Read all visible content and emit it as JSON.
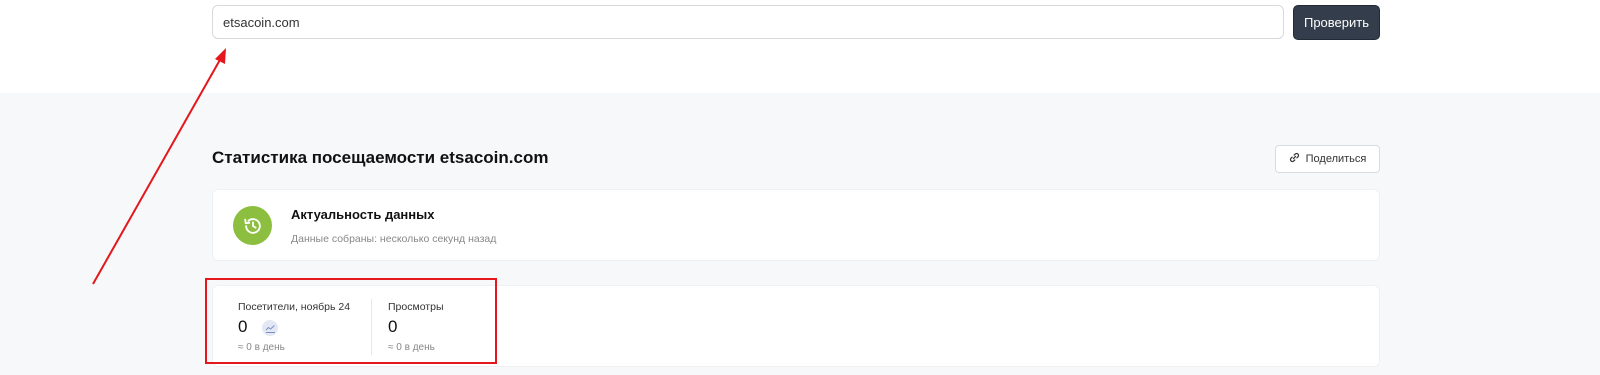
{
  "search": {
    "value": "etsacoin.com",
    "button_label": "Проверить"
  },
  "stats_section": {
    "title": "Статистика посещаемости etsacoin.com",
    "share_label": "Поделиться"
  },
  "freshness": {
    "icon": "history-clock-icon",
    "title": "Актуальность данных",
    "subtitle": "Данные собраны: несколько секунд назад"
  },
  "stats": {
    "visitors": {
      "label": "Посетители, ноябрь 24",
      "value": "0",
      "per_day": "≈ 0 в день",
      "badge_icon": "chart-icon"
    },
    "views": {
      "label": "Просмотры",
      "value": "0",
      "per_day": "≈ 0 в день"
    }
  },
  "colors": {
    "accent_dark": "#343d4b",
    "freshness_green": "#8cbf3f",
    "annotation_red": "#e3171c",
    "section_bg": "#f7f8f9"
  }
}
